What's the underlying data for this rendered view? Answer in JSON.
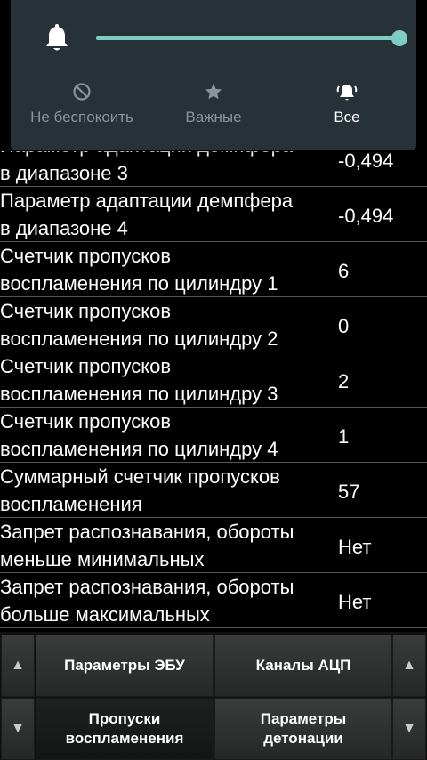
{
  "rows": [
    {
      "label": "Параметр адаптации демпфера\nв диапазоне 3",
      "value": "-0,494"
    },
    {
      "label": "Параметр адаптации демпфера\nв диапазоне 4",
      "value": "-0,494"
    },
    {
      "label": "Счетчик пропусков\nвоспламенения по цилиндру 1",
      "value": "6"
    },
    {
      "label": "Счетчик пропусков\nвоспламенения по цилиндру 2",
      "value": "0"
    },
    {
      "label": "Счетчик пропусков\nвоспламенения по цилиндру 3",
      "value": "2"
    },
    {
      "label": "Счетчик пропусков\nвоспламенения по цилиндру 4",
      "value": "1"
    },
    {
      "label": "Суммарный счетчик пропусков\nвоспламенения",
      "value": "57"
    },
    {
      "label": "Запрет распознавания, обороты\nменьше минимальных",
      "value": "Нет"
    },
    {
      "label": "Запрет распознавания, обороты\nбольше максимальных",
      "value": "Нет"
    }
  ],
  "toolbar": {
    "ecu_params": "Параметры ЭБУ",
    "adc_channels": "Каналы АЦП",
    "misfires": "Пропуски\nвоспламенения",
    "knock_params": "Параметры\nдетонации",
    "arrow_up": "▲",
    "arrow_down": "▼"
  },
  "notification_panel": {
    "volume_level": 1.0,
    "accent_color": "#80cbc4",
    "modes": [
      {
        "label": "Не беспокоить",
        "icon": "do-not-disturb-icon"
      },
      {
        "label": "Важные",
        "icon": "star-icon"
      },
      {
        "label": "Все",
        "icon": "bell-ringing-icon",
        "selected": true
      }
    ]
  }
}
